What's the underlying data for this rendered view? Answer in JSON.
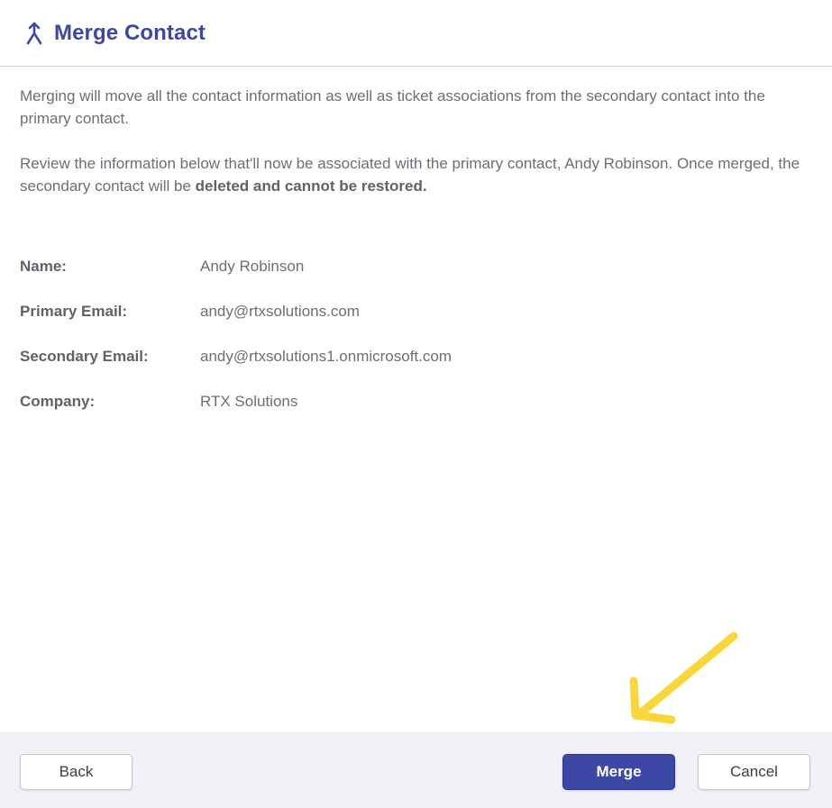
{
  "theme": {
    "accent": "#3d47a6",
    "accent_dark": "#2f3890",
    "arrow_color": "#f9d63a"
  },
  "header": {
    "icon": "merge-icon",
    "title": "Merge Contact"
  },
  "intro": {
    "paragraph1": "Merging will move all the contact information as well as ticket associations from the secondary contact into the primary contact.",
    "paragraph2_prefix": "Review the information below that'll now be associated with the primary contact, Andy Robinson. Once merged, the secondary contact will be ",
    "paragraph2_bold": "deleted and cannot be restored."
  },
  "fields": [
    {
      "label": "Name:",
      "value": "Andy Robinson"
    },
    {
      "label": "Primary Email:",
      "value": "andy@rtxsolutions.com"
    },
    {
      "label": "Secondary Email:",
      "value": "andy@rtxsolutions1.onmicrosoft.com"
    },
    {
      "label": "Company:",
      "value": "RTX Solutions"
    }
  ],
  "annotation": {
    "icon": "arrow-annotation-icon"
  },
  "footer": {
    "back_label": "Back",
    "merge_label": "Merge",
    "cancel_label": "Cancel"
  }
}
